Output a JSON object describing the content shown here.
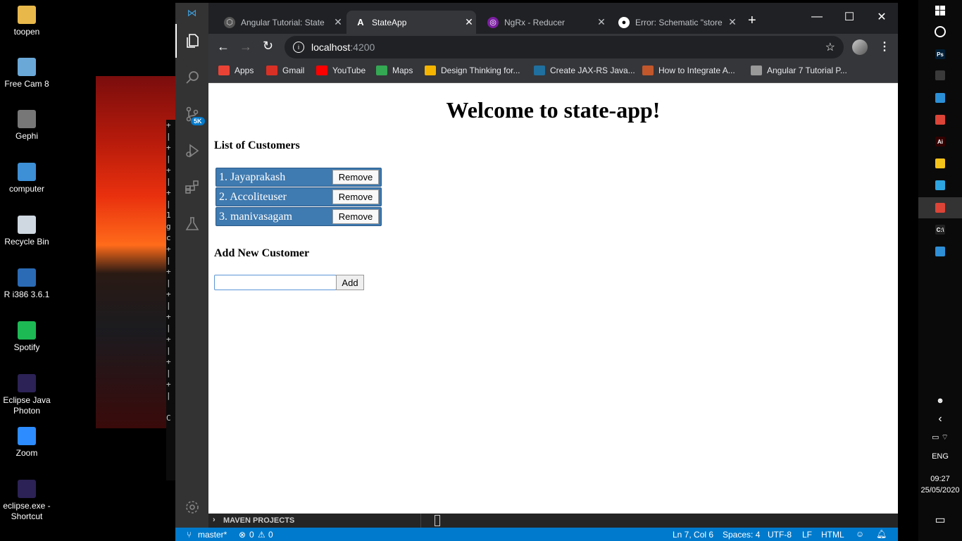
{
  "desktop": {
    "icons": [
      {
        "label": "toopen",
        "icon": "folder-icon",
        "color": "#e8b84a"
      },
      {
        "label": "Free Cam 8",
        "icon": "screen-recorder-icon",
        "color": "#6aa8d8"
      },
      {
        "label": "Gephi",
        "icon": "gephi-icon",
        "color": "#777777"
      },
      {
        "label": "computer",
        "icon": "computer-icon",
        "color": "#3d8fd6"
      },
      {
        "label": "Recycle Bin",
        "icon": "recycle-bin-icon",
        "color": "#cfd8e0"
      },
      {
        "label": "R i386 3.6.1",
        "icon": "r-language-icon",
        "color": "#2b6bb5"
      },
      {
        "label": "Spotify",
        "icon": "spotify-icon",
        "color": "#1db954"
      },
      {
        "label": "Eclipse Java Photon",
        "icon": "eclipse-icon",
        "color": "#2c2255"
      },
      {
        "label": "Zoom",
        "icon": "zoom-icon",
        "color": "#2d8cff"
      },
      {
        "label": "eclipse.exe - Shortcut",
        "icon": "eclipse-icon",
        "color": "#2c2255"
      }
    ]
  },
  "vscode": {
    "activity": [
      "files-icon",
      "search-icon",
      "source-control-icon",
      "run-debug-icon",
      "extensions-icon",
      "testing-icon"
    ],
    "scm_badge": "5K",
    "maven_label": "MAVEN PROJECTS",
    "status": {
      "branch": "master*",
      "errors": "0",
      "warnings": "0",
      "position": "Ln 7, Col 6",
      "spaces": "Spaces: 4",
      "encoding": "UTF-8",
      "eol": "LF",
      "language": "HTML"
    }
  },
  "browser": {
    "tabs": [
      {
        "title": "Angular Tutorial: State",
        "icon": "angular-icon",
        "active": false
      },
      {
        "title": "StateApp",
        "icon": "angular-icon",
        "active": true
      },
      {
        "title": "NgRx - Reducer",
        "icon": "ngrx-icon",
        "active": false
      },
      {
        "title": "Error: Schematic \"store",
        "icon": "github-icon",
        "active": false
      }
    ],
    "url_host": "localhost",
    "url_port": ":4200",
    "bookmarks": [
      {
        "label": "Apps",
        "color": "#ea4335"
      },
      {
        "label": "Gmail",
        "color": "#d93025"
      },
      {
        "label": "YouTube",
        "color": "#ff0000"
      },
      {
        "label": "Maps",
        "color": "#34a853"
      },
      {
        "label": "Design Thinking for...",
        "color": "#f4b400"
      },
      {
        "label": "Create JAX-RS Java...",
        "color": "#1f6f9f"
      },
      {
        "label": "How to Integrate A...",
        "color": "#c2572b"
      },
      {
        "label": "Angular 7 Tutorial P...",
        "color": "#999999"
      }
    ]
  },
  "page": {
    "title": "Welcome to state-app!",
    "list_heading": "List of Customers",
    "customers": [
      {
        "name": "1. Jayaprakash",
        "button": "Remove"
      },
      {
        "name": "2. Accoliteuser",
        "button": "Remove"
      },
      {
        "name": "3. manivasagam",
        "button": "Remove"
      }
    ],
    "add_heading": "Add New Customer",
    "add_input_value": "",
    "add_button": "Add"
  },
  "taskbar": {
    "language": "ENG",
    "time": "09:27",
    "date": "25/05/2020",
    "apps": [
      {
        "name": "start-icon"
      },
      {
        "name": "cortana-icon"
      },
      {
        "name": "photoshop-icon",
        "text": "Ps",
        "color": "#001e36"
      },
      {
        "name": "camera-app-icon",
        "color": "#3a3a3a"
      },
      {
        "name": "network-app-icon",
        "color": "#2b8fd6"
      },
      {
        "name": "chrome-icon",
        "color": "#db4437"
      },
      {
        "name": "illustrator-icon",
        "text": "Ai",
        "color": "#330000"
      },
      {
        "name": "file-explorer-icon",
        "color": "#f3c21b"
      },
      {
        "name": "telegram-icon",
        "color": "#2ca5e0"
      },
      {
        "name": "chrome-icon",
        "color": "#db4437"
      },
      {
        "name": "cmd-icon",
        "text": "C:\\",
        "color": "#222222"
      },
      {
        "name": "vscode-icon",
        "color": "#2e8fd6"
      }
    ]
  }
}
